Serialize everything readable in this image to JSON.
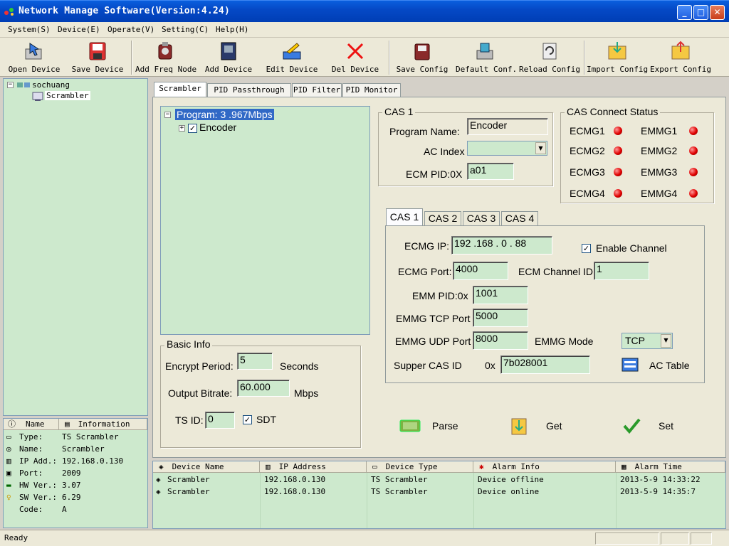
{
  "window": {
    "title": "Network Manage Software(Version:4.24)"
  },
  "menu": [
    "System(S)",
    "Device(E)",
    "Operate(V)",
    "Setting(C)",
    "Help(H)"
  ],
  "toolbar": [
    "Open Device",
    "Save Device",
    "Add Freq Node",
    "Add Device",
    "Edit Device",
    "Del Device",
    "Save Config",
    "Default Conf.",
    "Reload Config",
    "Import Config",
    "Export Config"
  ],
  "tree": {
    "root": "sochuang",
    "child": "Scrambler"
  },
  "info": {
    "headers": [
      "Name",
      "Information"
    ],
    "rows": [
      {
        "name": "Type:",
        "value": "TS Scrambler"
      },
      {
        "name": "Name:",
        "value": "Scrambler"
      },
      {
        "name": "IP Add.:",
        "value": "192.168.0.130"
      },
      {
        "name": "Port:",
        "value": "2009"
      },
      {
        "name": "HW Ver.:",
        "value": "3.07"
      },
      {
        "name": "SW Ver.:",
        "value": "6.29"
      },
      {
        "name": "Code:",
        "value": "A"
      }
    ]
  },
  "tabs": [
    "Scrambler",
    "PID Passthrough",
    "PID Filter",
    "PID Monitor"
  ],
  "program": {
    "label": "Program: 3 .967Mbps",
    "child": "Encoder"
  },
  "basic": {
    "title": "Basic Info",
    "encrypt_label": "Encrypt Period:",
    "encrypt_value": "5",
    "encrypt_unit": "Seconds",
    "bitrate_label": "Output Bitrate:",
    "bitrate_value": "60.000",
    "bitrate_unit": "Mbps",
    "tsid_label": "TS ID:",
    "tsid_value": "0",
    "sdt_label": "SDT"
  },
  "cas1": {
    "title": "CAS 1",
    "program_name_label": "Program Name:",
    "program_name": "Encoder",
    "ac_index_label": "AC Index",
    "ac_index": "",
    "ecm_pid_label": "ECM PID:0X",
    "ecm_pid": "a01"
  },
  "status": {
    "title": "CAS Connect Status",
    "ecmg": [
      "ECMG1",
      "ECMG2",
      "ECMG3",
      "ECMG4"
    ],
    "emmg": [
      "EMMG1",
      "EMMG2",
      "EMMG3",
      "EMMG4"
    ]
  },
  "castabs": [
    "CAS 1",
    "CAS 2",
    "CAS 3",
    "CAS 4"
  ],
  "cascfg": {
    "ecmg_ip_label": "ECMG IP:",
    "ecmg_ip": "192 .168 .  0  . 88",
    "enable_label": "Enable Channel",
    "ecmg_port_label": "ECMG Port:",
    "ecmg_port": "4000",
    "channel_id_label": "ECM Channel ID",
    "channel_id": "1",
    "emm_pid_label": "EMM PID:0x",
    "emm_pid": "1001",
    "emmg_tcp_label": "EMMG TCP Port",
    "emmg_tcp": "5000",
    "emmg_udp_label": "EMMG UDP Port",
    "emmg_udp": "8000",
    "emmg_mode_label": "EMMG Mode",
    "emmg_mode": "TCP",
    "super_cas_label": "Supper CAS ID",
    "super_cas_prefix": "0x",
    "super_cas": "7b028001",
    "ac_table_label": "AC Table"
  },
  "actions": {
    "parse": "Parse",
    "get": "Get",
    "set": "Set"
  },
  "alarm": {
    "headers": [
      "Device Name",
      "IP Address",
      "Device Type",
      "Alarm Info",
      "Alarm Time"
    ],
    "rows": [
      [
        "Scrambler",
        "192.168.0.130",
        "TS Scrambler",
        "Device offline",
        "2013-5-9 14:33:22"
      ],
      [
        "Scrambler",
        "192.168.0.130",
        "TS Scrambler",
        "Device online",
        "2013-5-9 14:35:7"
      ]
    ]
  },
  "statusbar": {
    "text": "Ready"
  },
  "colors": {
    "panel_green": "#cde9cd",
    "led_red": "#e00000",
    "title_blue": "#0549c6"
  }
}
